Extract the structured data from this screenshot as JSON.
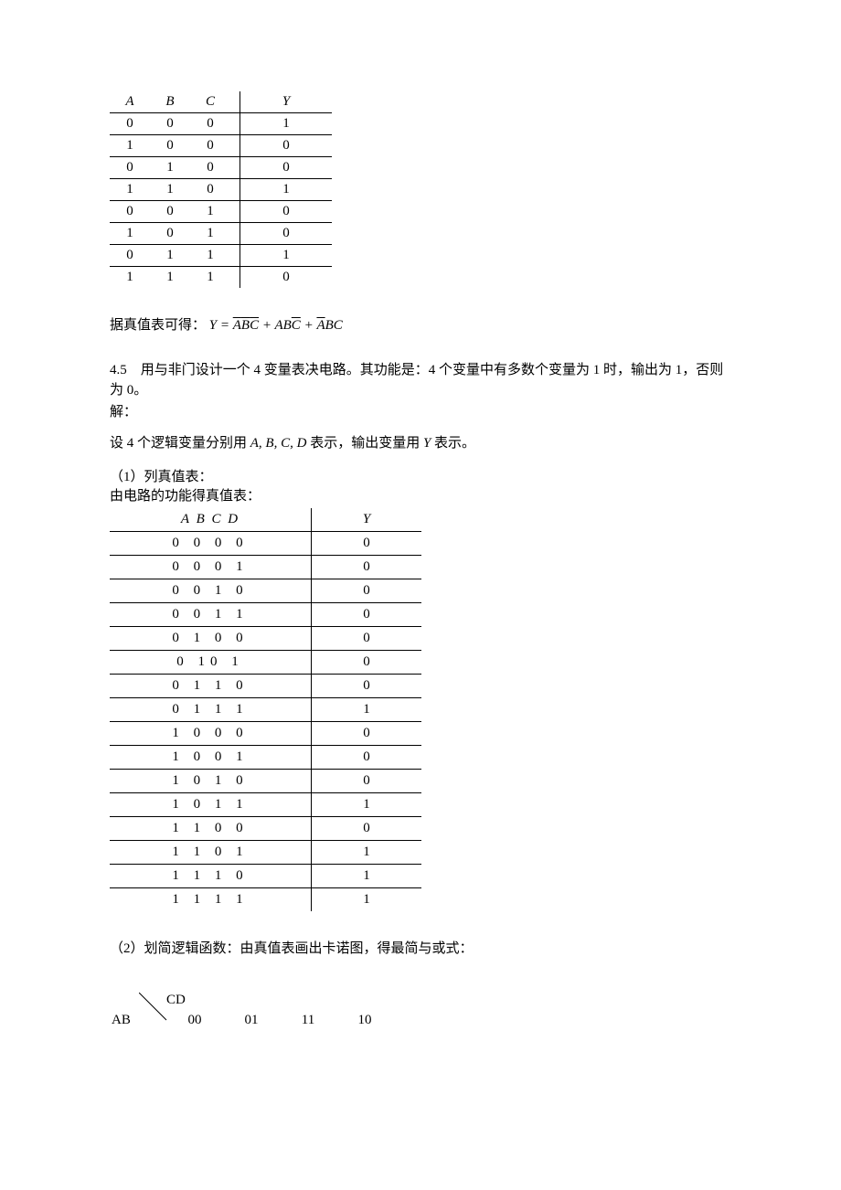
{
  "table3": {
    "headers": {
      "A": "A",
      "B": "B",
      "C": "C",
      "Y": "Y"
    },
    "rows": [
      {
        "A": "0",
        "B": "0",
        "C": "0",
        "Y": "1"
      },
      {
        "A": "1",
        "B": "0",
        "C": "0",
        "Y": "0"
      },
      {
        "A": "0",
        "B": "1",
        "C": "0",
        "Y": "0"
      },
      {
        "A": "1",
        "B": "1",
        "C": "0",
        "Y": "1"
      },
      {
        "A": "0",
        "B": "0",
        "C": "1",
        "Y": "0"
      },
      {
        "A": "1",
        "B": "0",
        "C": "1",
        "Y": "0"
      },
      {
        "A": "0",
        "B": "1",
        "C": "1",
        "Y": "1"
      },
      {
        "A": "1",
        "B": "1",
        "C": "1",
        "Y": "0"
      }
    ]
  },
  "derive_text_prefix": "据真值表可得：",
  "formula": {
    "lhs": "Y",
    "eq": " = ",
    "t1_a": "A",
    "t1_b": "B",
    "t1_c": "C",
    "plus1": " + ",
    "t2_a": "A",
    "t2_b": "B",
    "t2_c": "C",
    "plus2": " + ",
    "t3_a": "A",
    "t3_b": "B",
    "t3_c": "C"
  },
  "problem_text": "4.5 用与非门设计一个 4 变量表决电路。其功能是：4 个变量中有多数个变量为 1 时，输出为 1，否则为 0。",
  "solution_label": "解：",
  "vars_text_1": "设 4 个逻辑变量分别用 ",
  "vars_list": "A, B, C, D",
  "vars_text_2": " 表示，输出变量用 ",
  "vars_y": "Y",
  "vars_text_3": " 表示。",
  "step1_title": "（1）列真值表：",
  "step1_sub": "由电路的功能得真值表：",
  "table4": {
    "headers": {
      "ABCD": "A B C D",
      "Y": "Y"
    },
    "rows": [
      {
        "ABCD": "0 0 0 0",
        "Y": "0"
      },
      {
        "ABCD": "0 0 0 1",
        "Y": "0"
      },
      {
        "ABCD": "0 0 1 0",
        "Y": "0"
      },
      {
        "ABCD": "0 0 1 1",
        "Y": "0"
      },
      {
        "ABCD": "0 1 0 0",
        "Y": "0"
      },
      {
        "ABCD": "0 10 1",
        "Y": "0"
      },
      {
        "ABCD": "0 1 1 0",
        "Y": "0"
      },
      {
        "ABCD": "0 1 1 1",
        "Y": "1"
      },
      {
        "ABCD": "1 0 0 0",
        "Y": "0"
      },
      {
        "ABCD": "1 0 0 1",
        "Y": "0"
      },
      {
        "ABCD": "1 0 1 0",
        "Y": "0"
      },
      {
        "ABCD": "1 0 1 1",
        "Y": "1"
      },
      {
        "ABCD": "1 1 0 0",
        "Y": "0"
      },
      {
        "ABCD": "1 1 0 1",
        "Y": "1"
      },
      {
        "ABCD": "1 1 1 0",
        "Y": "1"
      },
      {
        "ABCD": "1 1 1 1",
        "Y": "1"
      }
    ]
  },
  "step2_title": "（2）划简逻辑函数：由真值表画出卡诺图，得最简与或式：",
  "kmap": {
    "row_label": "AB",
    "col_label": "CD",
    "cols": [
      "00",
      "01",
      "11",
      "10"
    ]
  }
}
